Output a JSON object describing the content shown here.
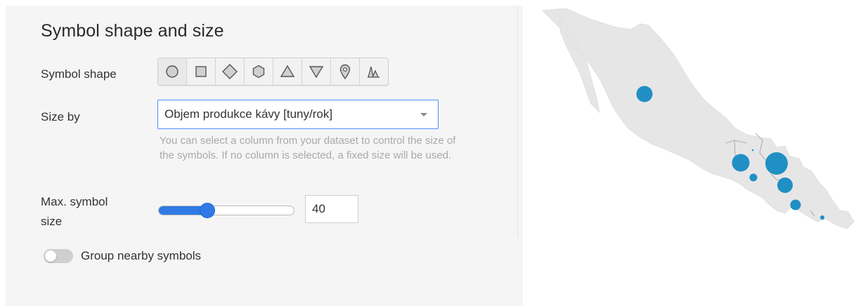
{
  "panel": {
    "title": "Symbol shape and size",
    "symbol_shape": {
      "label": "Symbol shape",
      "selected": "circle",
      "shapes": [
        "circle-icon",
        "square-icon",
        "diamond-icon",
        "hexagon-icon",
        "triangle-up-icon",
        "triangle-down-icon",
        "map-pin-icon",
        "spike-icon"
      ]
    },
    "size_by": {
      "label": "Size by",
      "value": "Objem produkce kávy [tuny/rok]",
      "help": "You can select a column from your dataset to control the size of the symbols. If no column is selected, a fixed size will be used."
    },
    "max_symbol_size": {
      "label_line1": "Max. symbol",
      "label_line2": "size",
      "value": "40",
      "slider_fraction": 0.36
    },
    "group_nearby": {
      "label": "Group nearby symbols",
      "enabled": false
    },
    "colors": {
      "accent": "#2f7ae5",
      "panel_bg": "#f5f5f5",
      "symbol": "#1f8fc4",
      "land": "#e6e6e6"
    }
  }
}
